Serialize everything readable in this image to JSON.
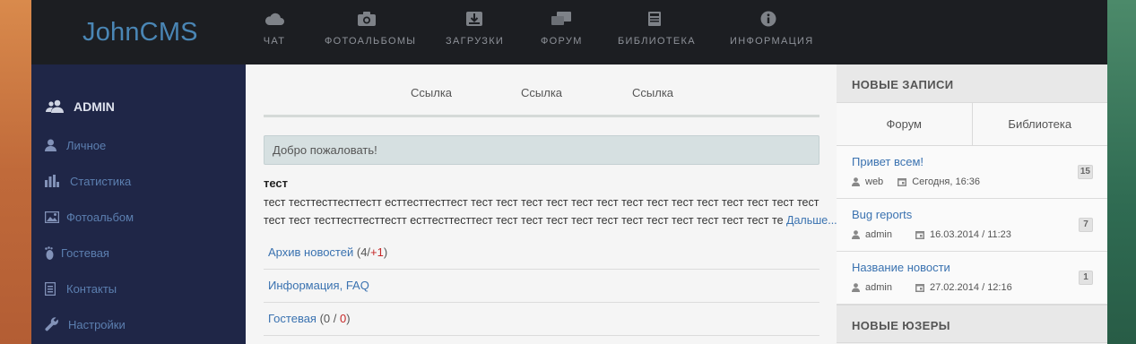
{
  "brand": {
    "logo": "JohnCMS"
  },
  "topnav": {
    "items": [
      {
        "label": "ЧАТ",
        "icon": "cloud-icon"
      },
      {
        "label": "ФОТОАЛЬБОМЫ",
        "icon": "camera-icon"
      },
      {
        "label": "ЗАГРУЗКИ",
        "icon": "download-box-icon"
      },
      {
        "label": "ФОРУМ",
        "icon": "chat-bubbles-icon"
      },
      {
        "label": "БИБЛИОТЕКА",
        "icon": "book-icon"
      },
      {
        "label": "ИНФОРМАЦИЯ",
        "icon": "info-icon"
      }
    ]
  },
  "sidebar": {
    "user": "ADMIN",
    "items": [
      {
        "label": "Личное",
        "icon": "user-icon"
      },
      {
        "label": "Статистика",
        "icon": "bar-chart-icon"
      },
      {
        "label": "Фотоальбом",
        "icon": "picture-icon"
      },
      {
        "label": "Гостевая",
        "icon": "footprint-icon"
      },
      {
        "label": "Контакты",
        "icon": "address-book-icon"
      },
      {
        "label": "Настройки",
        "icon": "wrench-icon"
      }
    ]
  },
  "main": {
    "links": [
      "Ссылка",
      "Ссылка",
      "Ссылка"
    ],
    "welcome": "Добро пожаловать!",
    "news": {
      "title": "тест",
      "line1": "тест тесттесттесттестт ecттесттесттест тест тест тест тест тест тест тест тест тест тест тест тест тест тест",
      "line2": "тест тест тесттесттесттестт ecттесттесттест тест тест тест тест тест тест тест тест тест тест тест те",
      "more": "Дальше..."
    },
    "list": [
      {
        "label": "Архив новостей",
        "open": " (",
        "count": "4",
        "sep": "/",
        "extra": "+1",
        "close": ")"
      },
      {
        "label": "Информация, FAQ"
      },
      {
        "label": "Гостевая",
        "open": " (",
        "count": "0",
        "sep": " / ",
        "extra": "0",
        "close": ")"
      }
    ]
  },
  "right": {
    "new_posts_title": "НОВЫЕ ЗАПИСИ",
    "tabs": [
      "Форум",
      "Библиотека"
    ],
    "posts": [
      {
        "title": "Привет всем!",
        "author": "web",
        "date": "Сегодня, 16:36",
        "count": "15"
      },
      {
        "title": "Bug reports",
        "author": "admin",
        "date": "16.03.2014 / 11:23",
        "count": "7"
      },
      {
        "title": "Название новости",
        "author": "admin",
        "date": "27.02.2014 / 12:16",
        "count": "1"
      }
    ],
    "new_users_title": "НОВЫЕ  ЮЗЕРЫ"
  },
  "colors": {
    "topbar": "#1c1e22",
    "sidebar": "#1f2647",
    "link": "#3a72b0",
    "accent_red": "#c62828"
  }
}
